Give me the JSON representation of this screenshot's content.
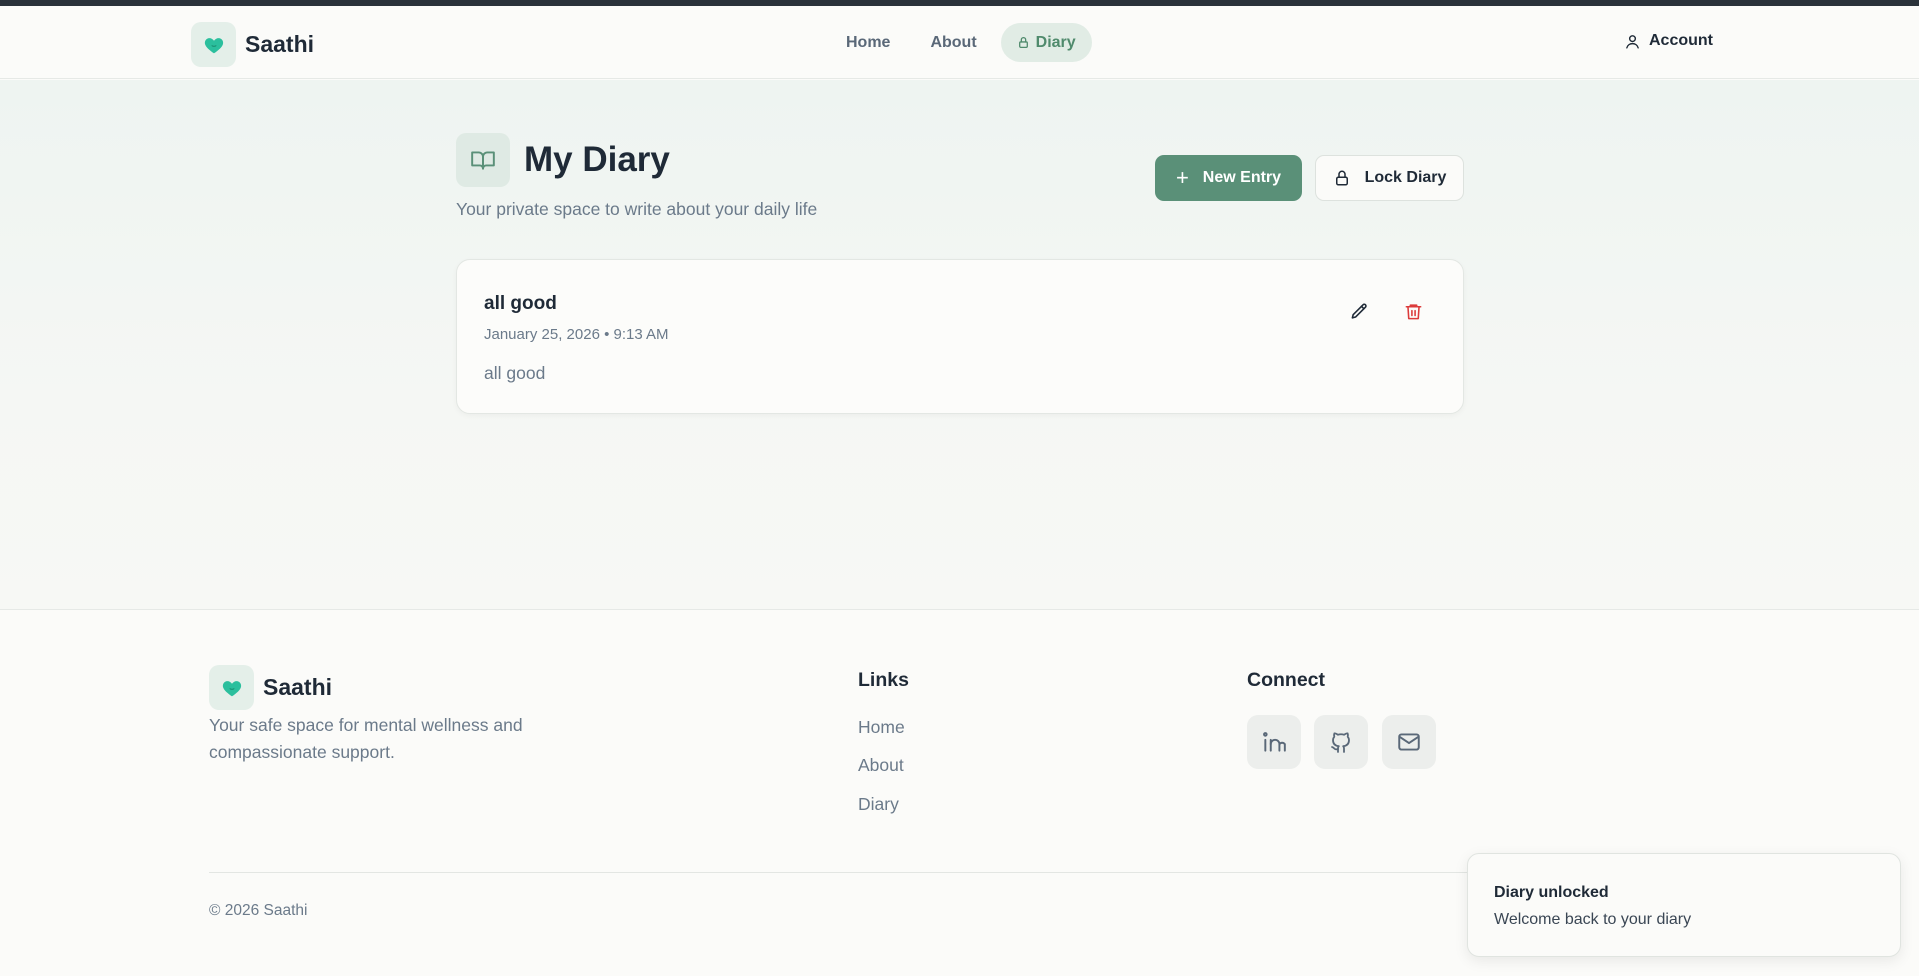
{
  "brand": {
    "name": "Saathi",
    "logo_icon": "heart-icon",
    "accent": "#2bbf9d"
  },
  "nav": {
    "items": [
      {
        "label": "Home"
      },
      {
        "label": "About"
      },
      {
        "label": "Diary",
        "icon": "lock-icon",
        "active": true
      }
    ],
    "account_label": "Account"
  },
  "page": {
    "title": "My Diary",
    "subtitle": "Your private space to write about your daily life",
    "new_entry_label": "New Entry",
    "lock_diary_label": "Lock Diary",
    "primary_color": "#5a9078"
  },
  "entries": [
    {
      "title": "all good",
      "date": "January 25, 2026 • 9:13 AM",
      "body": "all good"
    }
  ],
  "footer": {
    "brand_name": "Saathi",
    "tagline": "Your safe space for mental wellness and compassionate support.",
    "links_heading": "Links",
    "links": [
      "Home",
      "About",
      "Diary"
    ],
    "connect_heading": "Connect",
    "social": [
      "linkedin-icon",
      "github-icon",
      "mail-icon"
    ],
    "copyright": "© 2026 Saathi"
  },
  "toast": {
    "title": "Diary unlocked",
    "message": "Welcome back to your diary"
  },
  "colors": {
    "danger": "#dc3b3b"
  }
}
